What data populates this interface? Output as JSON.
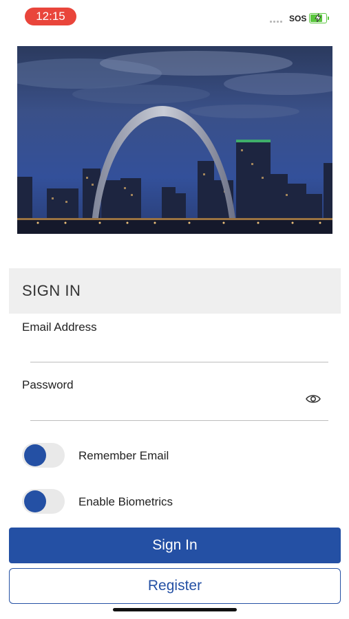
{
  "status_bar": {
    "time": "12:15",
    "carrier": "SOS",
    "battery_state": "charging",
    "time_pill_color": "#e9453b",
    "battery_color": "#5ac63e"
  },
  "hero_image": {
    "subject": "Gateway Arch and St. Louis skyline at dusk"
  },
  "sign_in_form": {
    "title": "SIGN IN",
    "email": {
      "label": "Email Address",
      "value": "",
      "placeholder": ""
    },
    "password": {
      "label": "Password",
      "value": "",
      "placeholder": "",
      "reveal_icon": "eye-icon"
    },
    "remember_email": {
      "label": "Remember Email",
      "checked": false
    },
    "enable_biometrics": {
      "label": "Enable Biometrics",
      "checked": false
    }
  },
  "actions": {
    "sign_in_label": "Sign In",
    "register_label": "Register"
  },
  "colors": {
    "primary": "#2450a4",
    "header_bg": "#efefef",
    "divider": "#bdbdbd"
  }
}
